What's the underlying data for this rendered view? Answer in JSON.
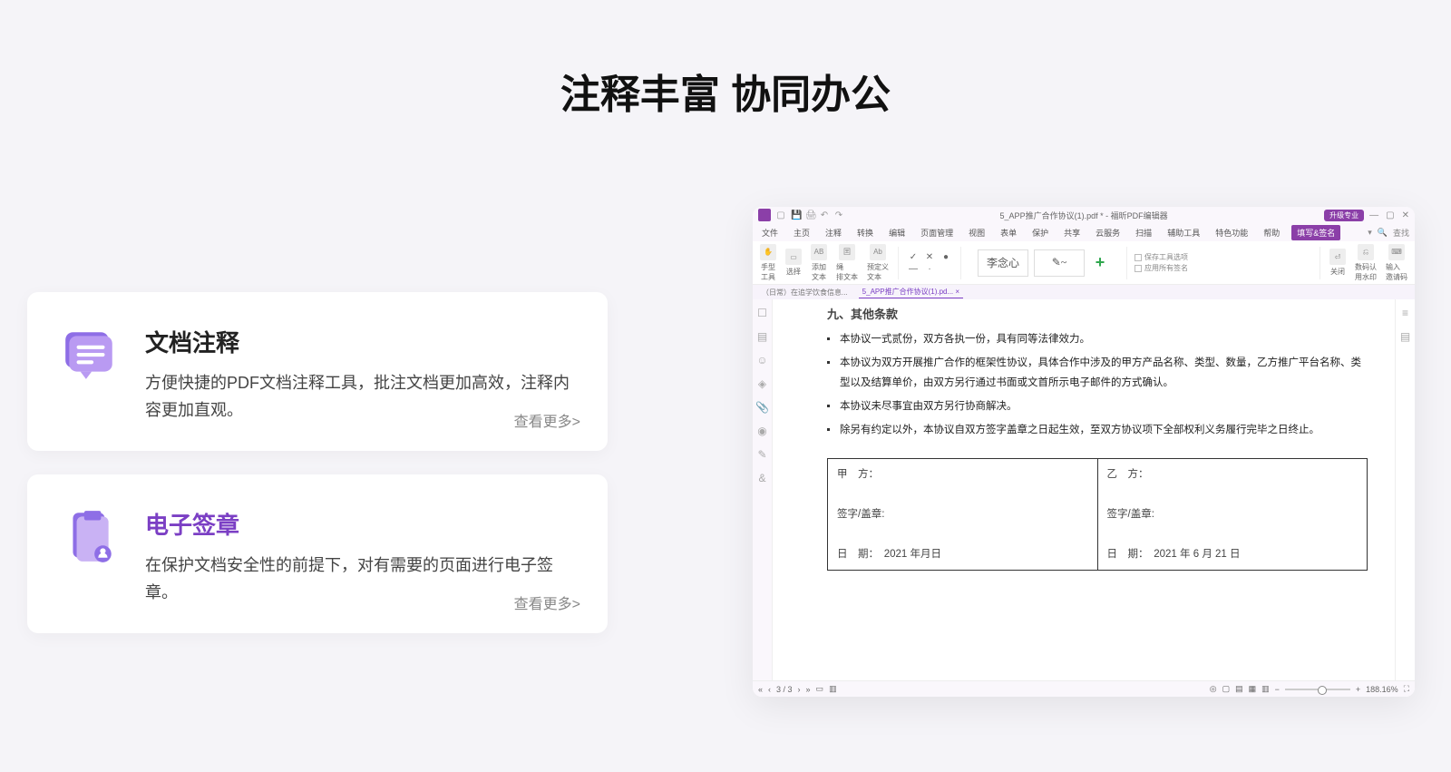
{
  "page": {
    "title_plain": "注释丰富 ",
    "title_highlight": "协同办公"
  },
  "features": [
    {
      "title": "文档注释",
      "desc": "方便快捷的PDF文档注释工具，批注文档更加高效，注释内容更加直观。",
      "more": "查看更多>",
      "accent": false
    },
    {
      "title": "电子签章",
      "desc": "在保护文档安全性的前提下，对有需要的页面进行电子签章。",
      "more": "查看更多>",
      "accent": true
    }
  ],
  "app": {
    "titlebar": {
      "doc_title": "5_APP推广合作协议(1).pdf * - 福昕PDF编辑器",
      "badge": "升级专业"
    },
    "menubar": {
      "items": [
        "文件",
        "主页",
        "注释",
        "转换",
        "编辑",
        "页面管理",
        "视图",
        "表单",
        "保护",
        "共享",
        "云服务",
        "扫描",
        "辅助工具",
        "特色功能",
        "帮助"
      ],
      "active": "填写&签名",
      "search_placeholder": "查找"
    },
    "ribbon": {
      "tools": [
        {
          "label": "手型\n工具",
          "glyph": "✋"
        },
        {
          "label": "选择",
          "glyph": "▭"
        },
        {
          "label": "添加\n文本",
          "glyph": "AB"
        },
        {
          "label": "绳\n排文本",
          "glyph": "囯"
        },
        {
          "label": "预定义\n文本",
          "glyph": "Ab"
        }
      ],
      "marks": [
        "✓",
        "✕",
        "●",
        "—",
        "·"
      ],
      "sigs": [
        "李念心",
        "✎~"
      ],
      "options": [
        "保存工具选项",
        "应用所有签名"
      ],
      "right_tools": [
        {
          "label": "关闭",
          "glyph": "⏎"
        },
        {
          "label": "数码认\n用水印",
          "glyph": "⎌"
        },
        {
          "label": "输入\n邀请码",
          "glyph": "⌨"
        }
      ]
    },
    "tabs": [
      "（日常）在追学饮食信息...",
      "5_APP推广合作协议(1).pd..."
    ],
    "active_tab": 1,
    "doc": {
      "heading": "九、其他条款",
      "bullets": [
        "本协议一式贰份，双方各执一份，具有同等法律效力。",
        "本协议为双方开展推广合作的框架性协议，具体合作中涉及的甲方产品名称、类型、数量，乙方推广平台名称、类型以及结算单价，由双方另行通过书面或文首所示电子邮件的方式确认。",
        "本协议未尽事宜由双方另行协商解决。",
        "除另有约定以外，本协议自双方签字盖章之日起生效，至双方协议项下全部权利义务履行完毕之日终止。"
      ],
      "table": {
        "a_party_label": "甲　方：",
        "b_party_label": "乙　方：",
        "sign_label": "签字/盖章:",
        "a_date": "日　期：　2021 年月日",
        "b_date": "日　期：　2021 年 6 月 21 日"
      }
    },
    "status": {
      "page": "3 / 3",
      "zoom": "188.16%"
    }
  }
}
